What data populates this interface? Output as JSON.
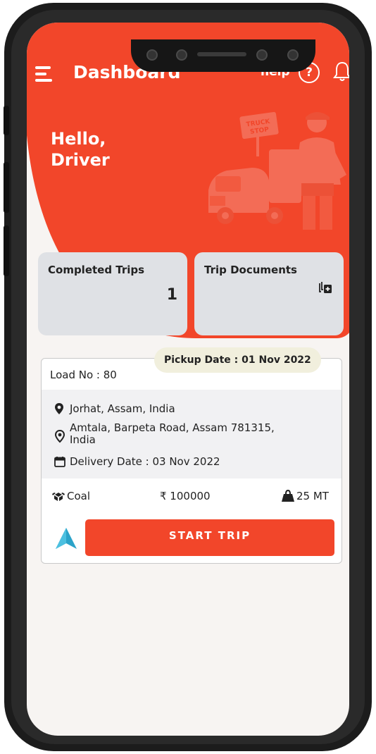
{
  "header": {
    "title": "Dashboard",
    "help_label": "help",
    "help_icon": "?",
    "brand_color": "#f2462a"
  },
  "greeting": {
    "line1": "Hello,",
    "line2": "Driver"
  },
  "illustration": {
    "sign_line1": "TRUCK",
    "sign_line2": "STOP"
  },
  "cards": {
    "completed_trips": {
      "label": "Completed Trips",
      "value": "1"
    },
    "trip_documents": {
      "label": "Trip Documents",
      "icon": "copy-add-icon"
    }
  },
  "trip": {
    "pickup_date": "Pickup Date : 01 Nov 2022",
    "load_no": "Load No : 80",
    "origin": "Jorhat, Assam, India",
    "destination_line1": "Amtala, Barpeta Road, Assam 781315,",
    "destination_line2": "India",
    "delivery_date": "Delivery Date : 03 Nov 2022",
    "material": "Coal",
    "amount": "₹ 100000",
    "weight": "25 MT",
    "start_button": "START TRIP"
  }
}
